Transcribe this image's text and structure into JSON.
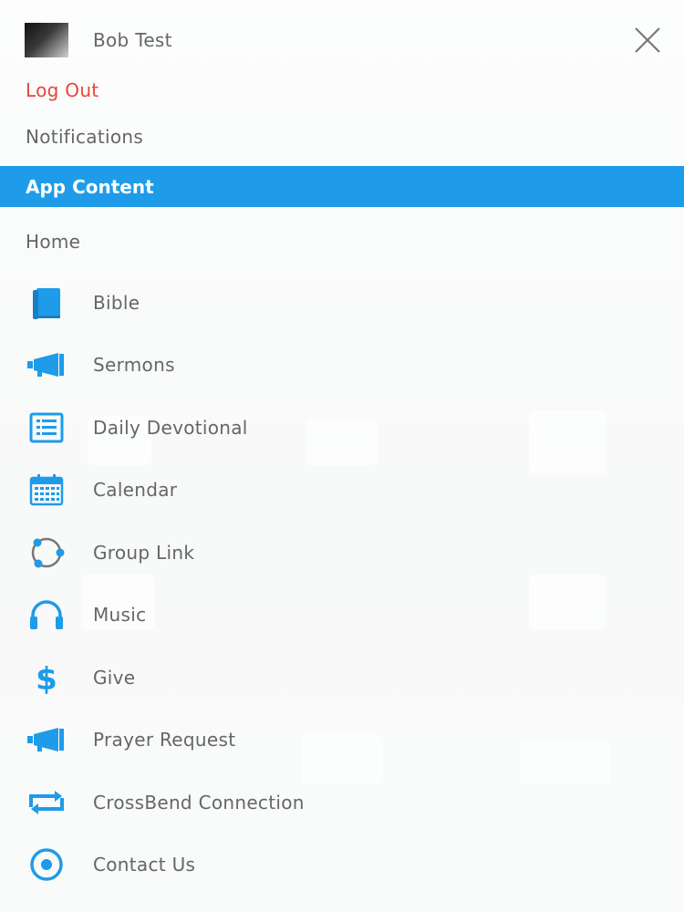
{
  "profile": {
    "name": "Bob Test"
  },
  "account": {
    "logout_label": "Log Out",
    "notifications_label": "Notifications"
  },
  "section": {
    "title": "App Content"
  },
  "home_label": "Home",
  "menu": [
    {
      "label": "Bible",
      "icon": "book-icon"
    },
    {
      "label": "Sermons",
      "icon": "megaphone-icon"
    },
    {
      "label": "Daily Devotional",
      "icon": "list-icon"
    },
    {
      "label": "Calendar",
      "icon": "calendar-icon"
    },
    {
      "label": "Group Link",
      "icon": "group-link-icon"
    },
    {
      "label": "Music",
      "icon": "headphones-icon"
    },
    {
      "label": "Give",
      "icon": "dollar-icon"
    },
    {
      "label": "Prayer Request",
      "icon": "megaphone-icon"
    },
    {
      "label": "CrossBend Connection",
      "icon": "repeat-icon"
    },
    {
      "label": "Contact Us",
      "icon": "target-icon"
    }
  ],
  "colors": {
    "accent": "#1e9be9",
    "logout": "#e8453c",
    "text": "#666666"
  }
}
